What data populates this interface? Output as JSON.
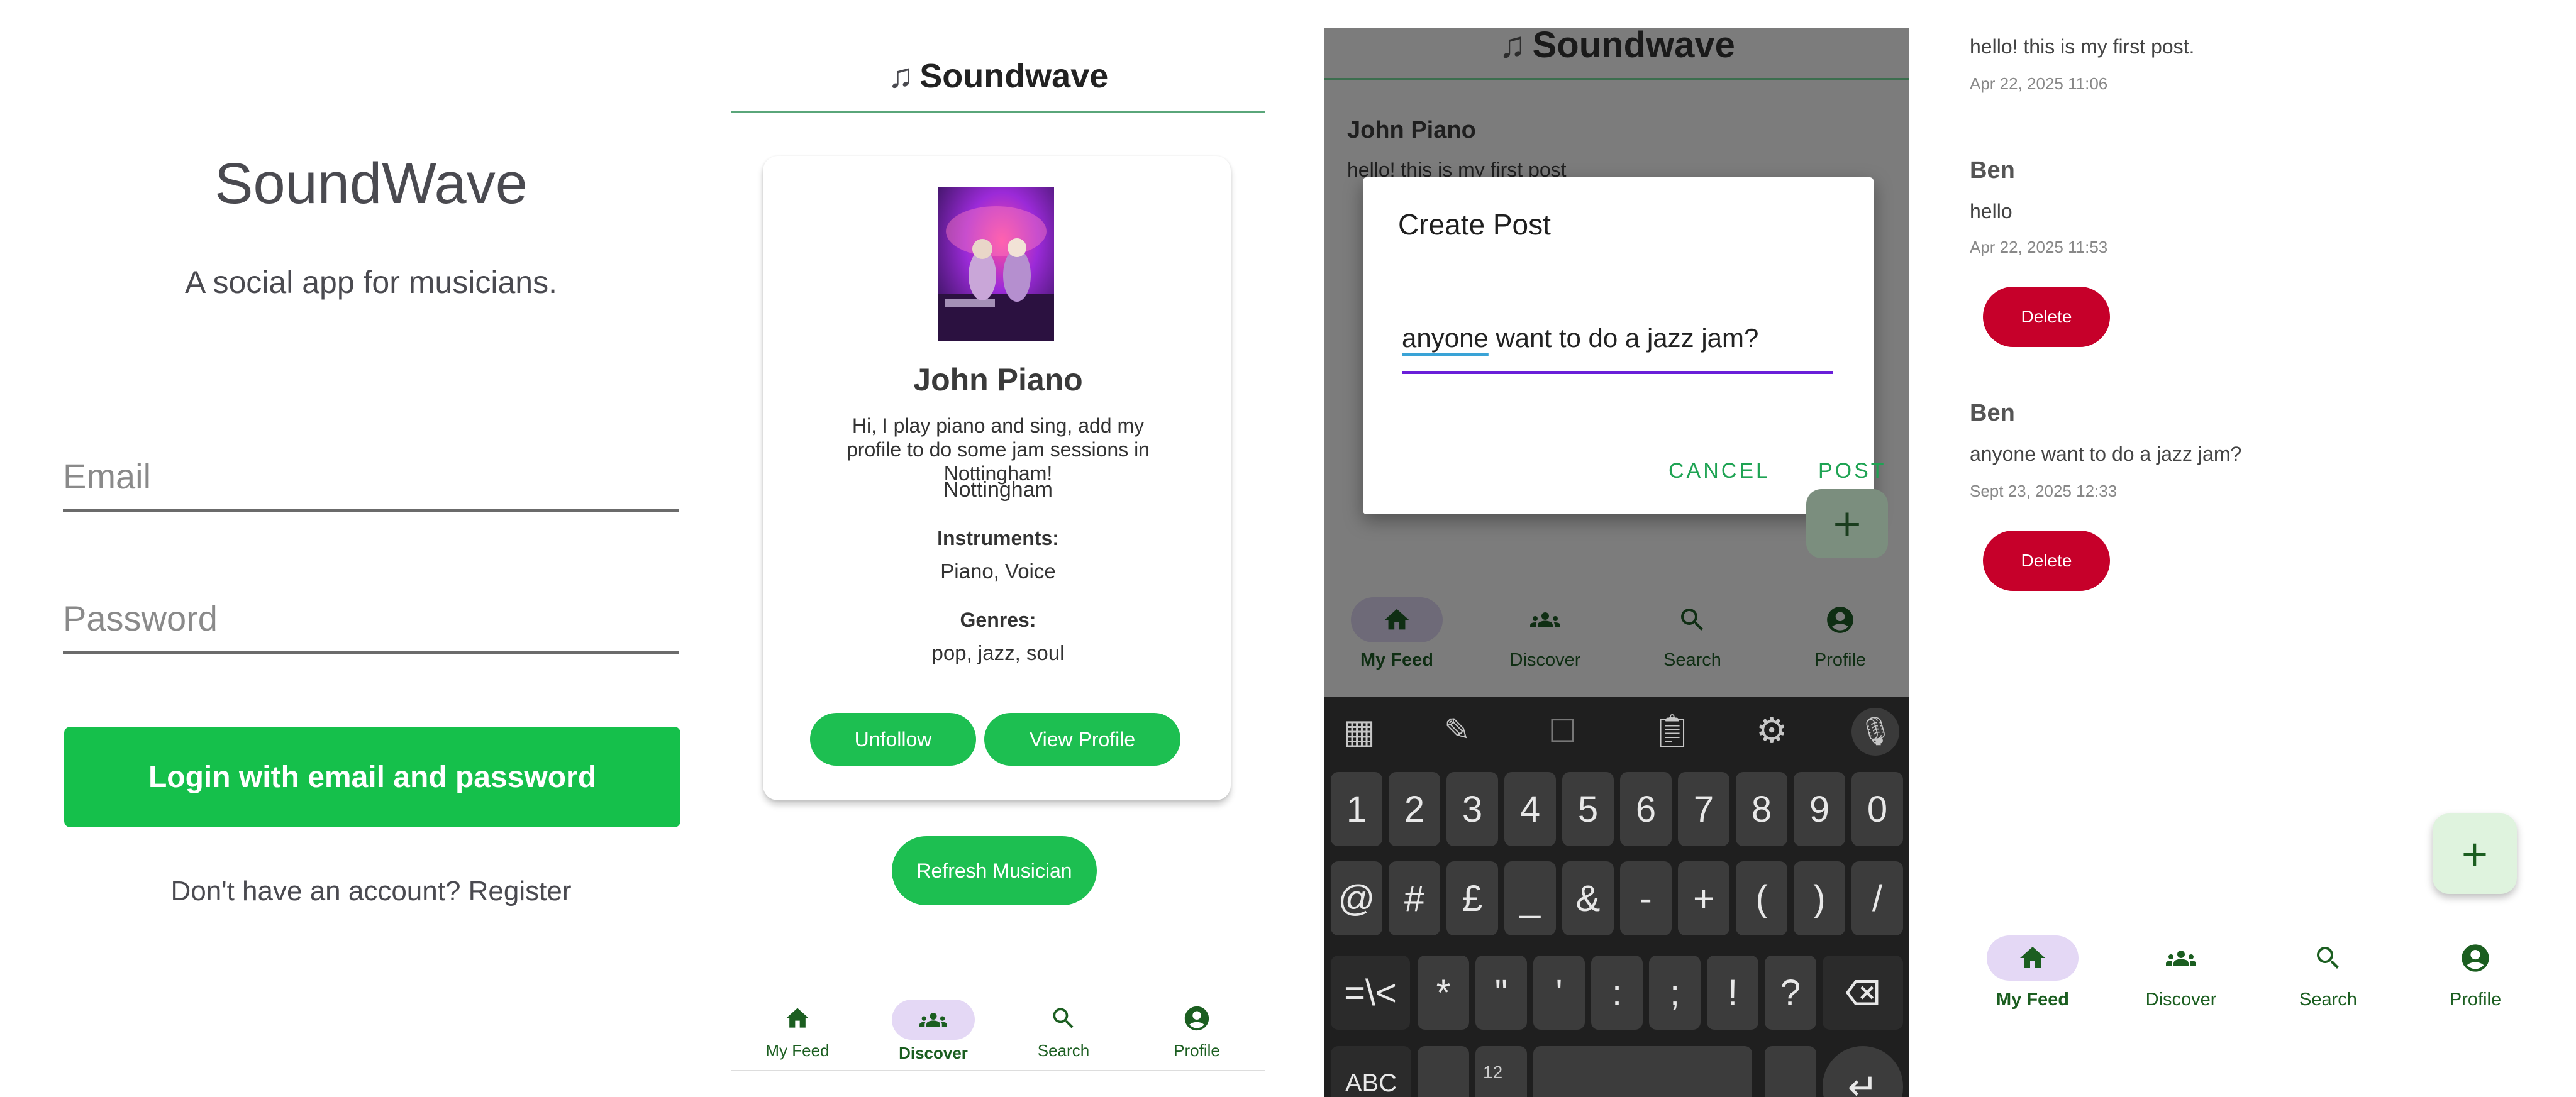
{
  "login": {
    "title": "SoundWave",
    "subtitle": "A social app for musicians.",
    "email_placeholder": "Email",
    "password_placeholder": "Password",
    "login_button": "Login with email and password",
    "register_link": "Don't have an account? Register"
  },
  "discover": {
    "app_title": "Soundwave",
    "musician": {
      "name": "John Piano",
      "bio": "Hi, I play piano and sing, add my profile to do some jam sessions in Nottingham!",
      "location": "Nottingham",
      "instruments_label": "Instruments:",
      "instruments": "Piano, Voice",
      "genres_label": "Genres:",
      "genres": "pop, jazz, soul"
    },
    "unfollow_button": "Unfollow",
    "view_profile_button": "View Profile",
    "refresh_button": "Refresh Musician",
    "nav": [
      {
        "label": "My Feed",
        "icon": "home-icon",
        "active": false
      },
      {
        "label": "Discover",
        "icon": "people-icon",
        "active": true
      },
      {
        "label": "Search",
        "icon": "search-icon",
        "active": false
      },
      {
        "label": "Profile",
        "icon": "account-icon",
        "active": false
      }
    ]
  },
  "create_post": {
    "app_title": "Soundwave",
    "background": {
      "author1": "John Piano",
      "post1": "hello! this is my first post"
    },
    "dialog_title": "Create Post",
    "input_underlined": "anyone",
    "input_rest": " want to do a jazz jam?",
    "cancel_button": "CANCEL",
    "post_button": "POST",
    "fab": "+",
    "nav": [
      {
        "label": "My Feed",
        "icon": "home-icon",
        "active": true
      },
      {
        "label": "Discover",
        "icon": "people-icon",
        "active": false
      },
      {
        "label": "Search",
        "icon": "search-icon",
        "active": false
      },
      {
        "label": "Profile",
        "icon": "account-icon",
        "active": false
      }
    ],
    "keyboard": {
      "row1": [
        "1",
        "2",
        "3",
        "4",
        "5",
        "6",
        "7",
        "8",
        "9",
        "0"
      ],
      "row2": [
        "@",
        "#",
        "£",
        "_",
        "&",
        "-",
        "+",
        "(",
        ")",
        "/"
      ],
      "row3": [
        "=\\<",
        "*",
        "\"",
        "'",
        ":",
        ";",
        "!",
        "?"
      ],
      "row4_left": "ABC",
      "row4_num": "12"
    }
  },
  "feed": {
    "posts": [
      {
        "body": "hello! this is my first post.",
        "time": "Apr 22, 2025 11:06"
      },
      {
        "author": "Ben",
        "body": "hello",
        "time": "Apr 22, 2025 11:53",
        "delete": "Delete"
      },
      {
        "author": "Ben",
        "body": "anyone want to do a jazz jam?",
        "time": "Sept 23, 2025 12:33",
        "delete": "Delete"
      }
    ],
    "fab": "+",
    "nav": [
      {
        "label": "My Feed",
        "icon": "home-icon",
        "active": true
      },
      {
        "label": "Discover",
        "icon": "people-icon",
        "active": false
      },
      {
        "label": "Search",
        "icon": "search-icon",
        "active": false
      },
      {
        "label": "Profile",
        "icon": "account-icon",
        "active": false
      }
    ]
  },
  "colors": {
    "primary_green": "#15c04b",
    "nav_green": "#1b5e20",
    "delete_red": "#c6002a",
    "input_focus": "#6a1fd9",
    "nav_active_pill": "#e4d8f5"
  }
}
